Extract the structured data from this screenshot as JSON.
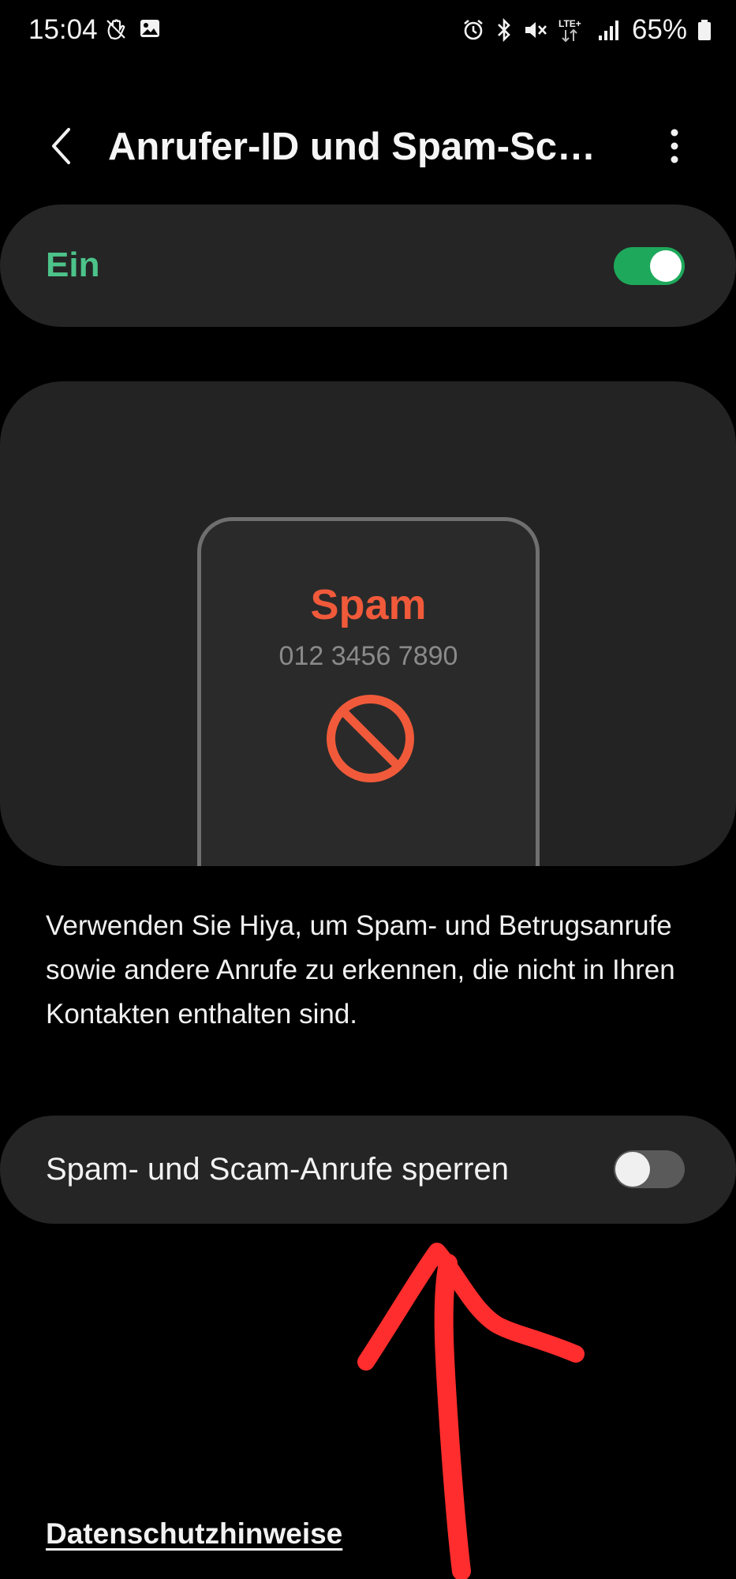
{
  "status_bar": {
    "time": "15:04",
    "battery_percent": "65%",
    "icons_left": [
      "touch-block-icon",
      "gallery-icon"
    ],
    "icons_right": [
      "alarm-icon",
      "bluetooth-icon",
      "mute-icon",
      "lte-plus-icon",
      "signal-icon",
      "battery-icon"
    ],
    "network_label": "LTE+"
  },
  "app_bar": {
    "title": "Anrufer-ID und Spam-Schutz",
    "back_icon": "chevron-left-icon",
    "more_icon": "more-vert-icon"
  },
  "master_switch": {
    "label": "Ein",
    "state": true,
    "label_color": "#4cc38a",
    "track_color": "#1ea85b"
  },
  "illustration": {
    "caller_label": "Spam",
    "caller_number": "012 3456 7890",
    "icon": "block-icon",
    "accent_color": "#f05a3a"
  },
  "description": "Verwenden Sie Hiya, um Spam- und Betrugsanrufe sowie andere Anrufe zu erkennen, die nicht in Ihren Kontakten enthalten sind.",
  "block_setting": {
    "label": "Spam- und Scam-Anrufe sperren",
    "state": false
  },
  "annotation": {
    "shape": "arrow-up",
    "color": "#ff2d2d"
  },
  "privacy_link": "Datenschutzhinweise"
}
